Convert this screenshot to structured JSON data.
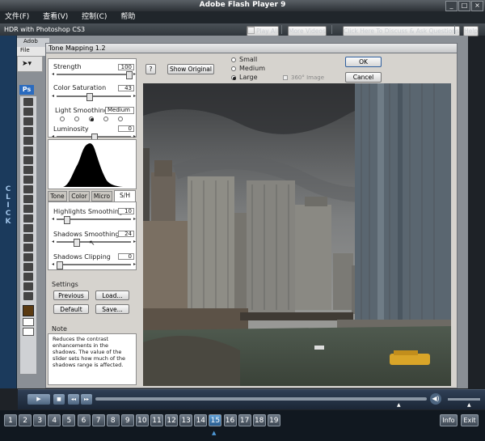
{
  "player": {
    "title": "Adobe Flash Player 9",
    "menu": [
      "文件(F)",
      "查看(V)",
      "控制(C)",
      "帮助"
    ],
    "window_controls": [
      "_",
      "□",
      "×"
    ],
    "click_strip": "CLICK"
  },
  "topbar": {
    "title": "HDR with Photoshop CS3",
    "play_all": "Play All",
    "more_videos": "More Videos",
    "discuss": "Click Here To Discuss & Ask Questions",
    "help": "Help"
  },
  "photoshop": {
    "app_label": "Adob",
    "menu_file": "File",
    "ps_badge": "Ps"
  },
  "dialog": {
    "title": "Tone Mapping 1.2",
    "help_button": "?",
    "show_original": "Show Original",
    "size_options": [
      "Small",
      "Medium",
      "Large"
    ],
    "size_selected": "Large",
    "image_360": "360° Image",
    "ok": "OK",
    "cancel": "Cancel",
    "strength": {
      "label": "Strength",
      "value": "100"
    },
    "color_saturation": {
      "label": "Color Saturation",
      "value": "43"
    },
    "light_smoothing": {
      "label": "Light Smoothing",
      "value": "Medium"
    },
    "luminosity": {
      "label": "Luminosity",
      "value": "0"
    },
    "tabs": [
      "Tone",
      "Color",
      "Micro",
      "S/H"
    ],
    "active_tab": "S/H",
    "highlights_smoothing": {
      "label": "Highlights Smoothing",
      "value": "10"
    },
    "shadows_smoothing": {
      "label": "Shadows Smoothing",
      "value": "24"
    },
    "shadows_clipping": {
      "label": "Shadows Clipping",
      "value": "0"
    },
    "settings_label": "Settings",
    "previous": "Previous",
    "load": "Load...",
    "default": "Default",
    "save": "Save...",
    "note_label": "Note",
    "note_text": "Reduces the contrast enhancements in the shadows. The value of the slider sets how much of the shadows range is affected."
  },
  "slider_levels": {
    "strength": 1.0,
    "color_saturation": 0.43,
    "luminosity": 0.5,
    "highlights_smoothing": 0.1,
    "shadows_smoothing": 0.24,
    "shadows_clipping": 0.0
  },
  "pages": {
    "numbers": [
      "1",
      "2",
      "3",
      "4",
      "5",
      "6",
      "7",
      "8",
      "9",
      "10",
      "11",
      "12",
      "13",
      "14",
      "15",
      "16",
      "17",
      "18",
      "19"
    ],
    "current": "15",
    "info": "Info",
    "exit": "Exit"
  },
  "colors": {
    "player_bg": "#1e2227",
    "click_strip": "#1b3a5c",
    "dialog_bg": "#d6d3ce",
    "page_button_active": "#2a5c8e"
  }
}
